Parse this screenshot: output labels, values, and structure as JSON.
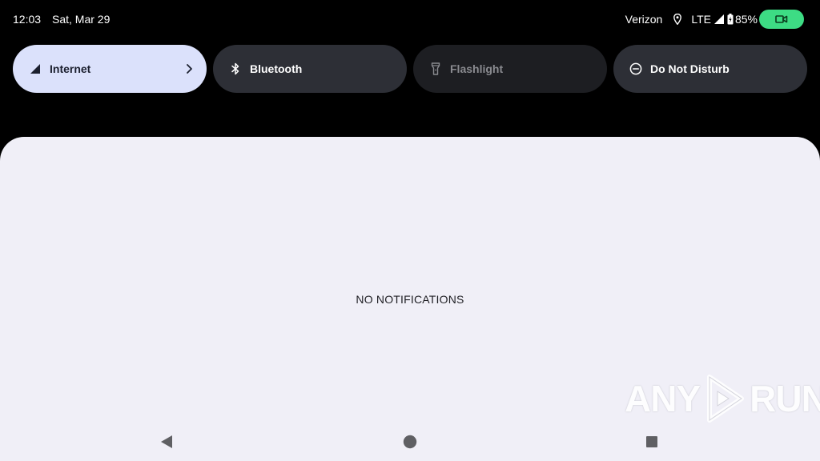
{
  "status_bar": {
    "time": "12:03",
    "date": "Sat, Mar 29",
    "carrier": "Verizon",
    "network_type": "LTE",
    "battery_percent": "85%",
    "icons": [
      "location-icon",
      "signal-icon",
      "battery-icon",
      "video-camera-icon"
    ]
  },
  "quick_settings": {
    "tiles": [
      {
        "label": "Internet",
        "icon": "cellular-signal-icon",
        "state": "on",
        "has_chevron": true
      },
      {
        "label": "Bluetooth",
        "icon": "bluetooth-icon",
        "state": "off"
      },
      {
        "label": "Flashlight",
        "icon": "flashlight-icon",
        "state": "unavailable"
      },
      {
        "label": "Do Not Disturb",
        "icon": "do-not-disturb-icon",
        "state": "off"
      }
    ]
  },
  "notifications": {
    "empty_text": "NO NOTIFICATIONS"
  },
  "navigation": {
    "buttons": [
      "back-icon",
      "home-icon",
      "recents-icon"
    ]
  },
  "watermark": {
    "left_text": "ANY",
    "right_text": "RUN"
  },
  "colors": {
    "accent_tile": "#dbe1fb",
    "dark_tile": "#2d2f36",
    "shade_background": "#f0eff7",
    "camera_indicator": "#3ddc84"
  }
}
